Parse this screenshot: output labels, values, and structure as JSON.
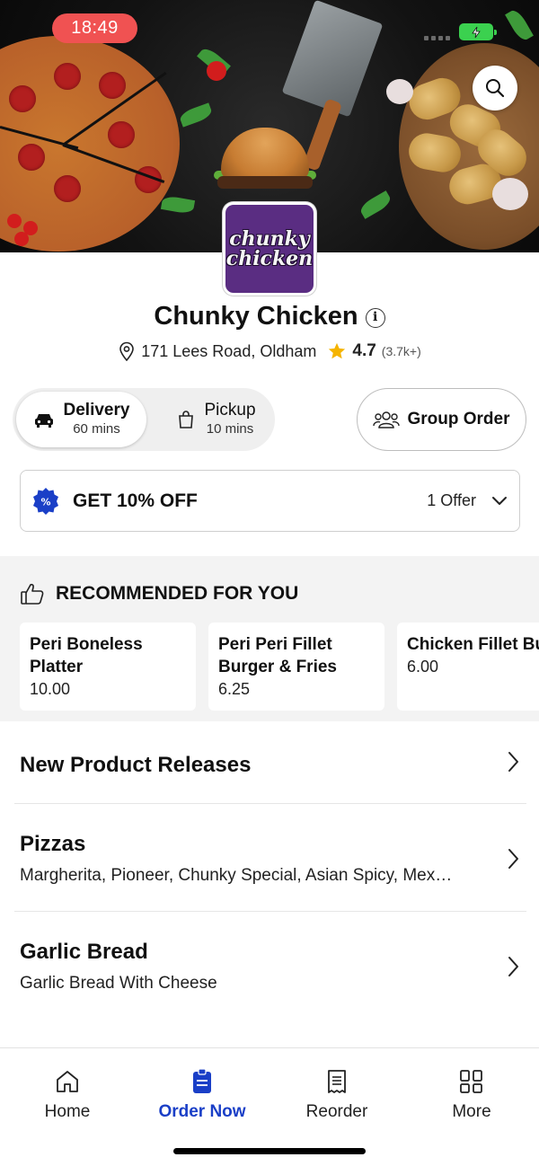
{
  "status_bar": {
    "time": "18:49"
  },
  "restaurant": {
    "logo_lines": [
      "chunky",
      "chicken"
    ],
    "name": "Chunky Chicken",
    "address": "171 Lees Road, Oldham",
    "rating": "4.7",
    "rating_count": "(3.7k+)"
  },
  "fulfilment": {
    "delivery": {
      "label": "Delivery",
      "time": "60 mins",
      "selected": true
    },
    "pickup": {
      "label": "Pickup",
      "time": "10 mins",
      "selected": false
    },
    "group_order_label": "Group Order"
  },
  "offer": {
    "title": "GET 10% OFF",
    "count": "1 Offer"
  },
  "recommended": {
    "heading": "RECOMMENDED FOR YOU",
    "items": [
      {
        "name": "Peri Boneless Platter",
        "price": "10.00"
      },
      {
        "name": "Peri Peri Fillet Burger & Fries",
        "price": "6.25"
      },
      {
        "name": "Chicken Fillet Burger & Fries",
        "price": "6.00"
      }
    ]
  },
  "categories": [
    {
      "title": "New Product Releases",
      "subtitle": ""
    },
    {
      "title": "Pizzas",
      "subtitle": "Margherita, Pioneer, Chunky Special, Asian Spicy, Mex…"
    },
    {
      "title": "Garlic Bread",
      "subtitle": "Garlic Bread With Cheese"
    }
  ],
  "tabbar": {
    "items": [
      {
        "label": "Home",
        "icon": "home-icon",
        "active": false
      },
      {
        "label": "Order Now",
        "icon": "order-icon",
        "active": true
      },
      {
        "label": "Reorder",
        "icon": "receipt-icon",
        "active": false
      },
      {
        "label": "More",
        "icon": "grid-icon",
        "active": false
      }
    ]
  },
  "colors": {
    "accent": "#1a3fc7",
    "status_pill": "#f05252",
    "battery": "#3bd14f",
    "logo_bg": "#5a2d82",
    "star": "#f5b400"
  }
}
